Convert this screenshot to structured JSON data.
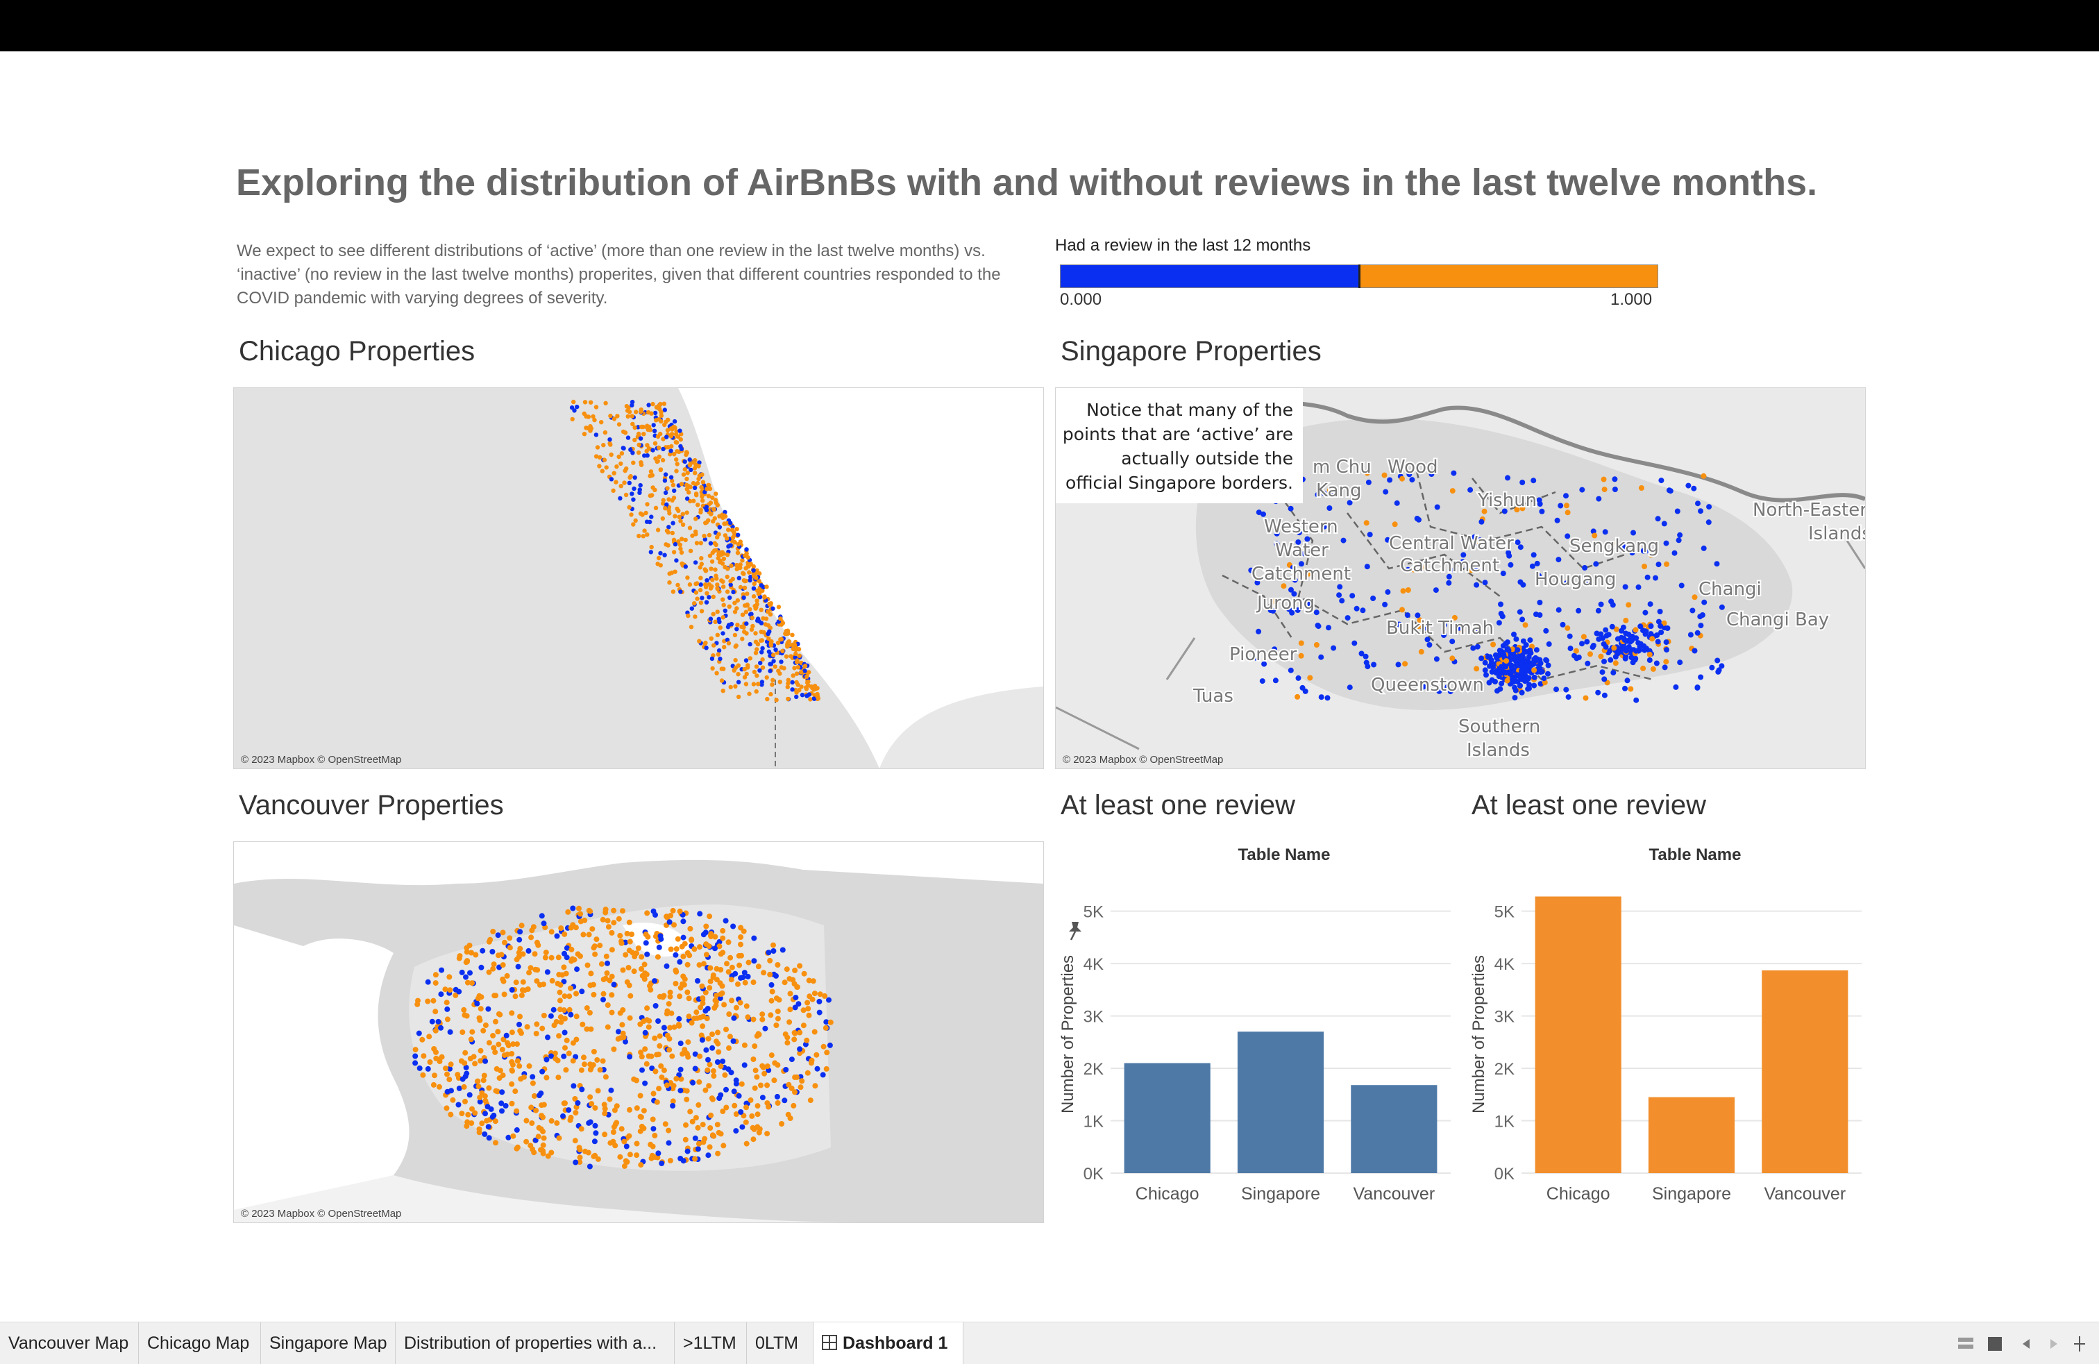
{
  "dashboard": {
    "title": "Exploring the distribution of AirBnBs with and without reviews in the last twelve months.",
    "description": "We expect to see different distributions of ‘active’ (more than one review in the last twelve months) vs. ‘inactive’ (no review in the last twelve months) properites, given that different countries responded to the COVID pandemic with varying degrees of severity."
  },
  "legend": {
    "title": "Had a review in the last 12 months",
    "min_label": "0.000",
    "max_label": "1.000",
    "colors": {
      "low": "#0b2ff0",
      "high": "#f7900f"
    }
  },
  "maps": {
    "chicago": {
      "title": "Chicago Properties",
      "credit": "© 2023 Mapbox © OpenStreetMap"
    },
    "singapore": {
      "title": "Singapore Properties",
      "credit": "© 2023 Mapbox © OpenStreetMap",
      "annotation": [
        "Notice that many of the",
        "points that are ‘active’ are",
        "actually outside the",
        "official Singapore borders."
      ],
      "place_labels": [
        "m Chu",
        "Kang",
        "Wood",
        "Yishun",
        "Western",
        "Water",
        "Catchment",
        "Central Water",
        "Catchment",
        "Jurong",
        "Bukit Timah",
        "Pioneer",
        "Tuas",
        "Queenstown",
        "Southern",
        "Islands",
        "North-Eastern",
        "Islands",
        "Changi",
        "Changi Bay",
        "Sengkang",
        "Hougang"
      ]
    },
    "vancouver": {
      "title": "Vancouver Properties",
      "credit": "© 2023 Mapbox © OpenStreetMap"
    }
  },
  "chart_data": [
    {
      "type": "bar",
      "title": "At least one review",
      "column_header": "Table Name",
      "ylabel": "Number of Properties",
      "categories": [
        "Chicago",
        "Singapore",
        "Vancouver"
      ],
      "values": [
        2100,
        2700,
        1680
      ],
      "ylim": [
        0,
        5300
      ],
      "yticks": [
        0,
        1000,
        2000,
        3000,
        4000,
        5000
      ],
      "ytick_labels": [
        "0K",
        "1K",
        "2K",
        "3K",
        "4K",
        "5K"
      ],
      "color": "#4e79a7",
      "grid": true
    },
    {
      "type": "bar",
      "title": "At least one review",
      "column_header": "Table Name",
      "ylabel": "Number of Properties",
      "categories": [
        "Chicago",
        "Singapore",
        "Vancouver"
      ],
      "values": [
        5280,
        1450,
        3870
      ],
      "ylim": [
        0,
        5300
      ],
      "yticks": [
        0,
        1000,
        2000,
        3000,
        4000,
        5000
      ],
      "ytick_labels": [
        "0K",
        "1K",
        "2K",
        "3K",
        "4K",
        "5K"
      ],
      "color": "#f28e2b",
      "grid": true
    }
  ],
  "tabs": [
    {
      "label": "Vancouver Map",
      "active": false
    },
    {
      "label": "Chicago Map",
      "active": false
    },
    {
      "label": "Singapore Map",
      "active": false
    },
    {
      "label": "Distribution of properties with a...",
      "active": false
    },
    {
      "label": ">1LTM",
      "active": false
    },
    {
      "label": "0LTM",
      "active": false
    },
    {
      "label": "Dashboard 1",
      "active": true
    }
  ],
  "controls": [
    "grid-view-icon",
    "filmstrip-view-icon",
    "previous-sheet-icon",
    "next-sheet-icon",
    "resize-handle-icon"
  ]
}
